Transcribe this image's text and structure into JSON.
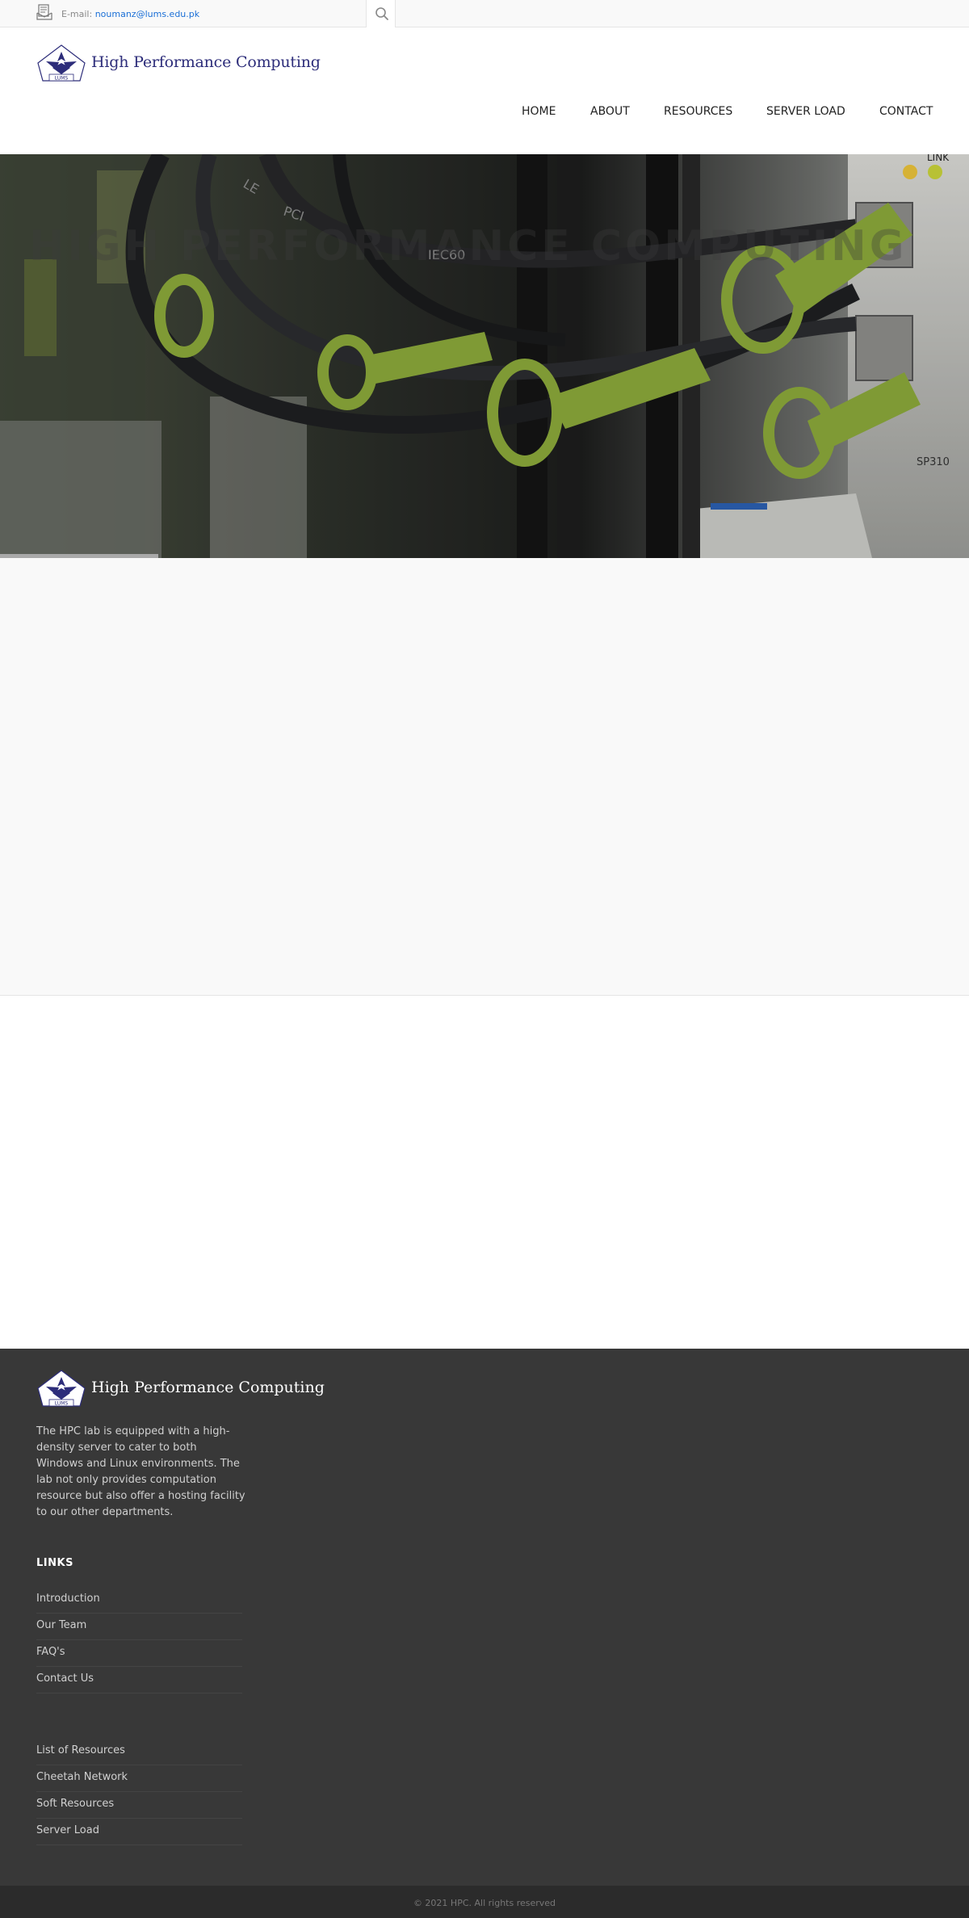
{
  "topbar": {
    "email_label": "E-mail:",
    "email": "noumanz@lums.edu.pk",
    "mail_icon": "mail-icon",
    "search_icon": "search-icon"
  },
  "header": {
    "logo_badge": "LUMS",
    "logo_text": "High Performance Computing",
    "nav": [
      {
        "label": "HOME"
      },
      {
        "label": "ABOUT"
      },
      {
        "label": "RESOURCES"
      },
      {
        "label": "SERVER LOAD"
      },
      {
        "label": "CONTACT"
      }
    ]
  },
  "hero": {
    "title": "HIGH PERFORMANCE COMPUTING",
    "progress": 0.163,
    "photo_labels": {
      "link": "LINK",
      "port": "SP310",
      "cable_a": "PCI",
      "cable_b": "IEC60",
      "cable_c": "LE"
    }
  },
  "footer": {
    "logo_text": "High Performance Computing",
    "about": "The HPC lab is equipped with a high-density server to cater to both Windows and Linux environments. The lab not only provides computation resource but also offer a hosting facility to our other departments.",
    "links_heading": "LINKS",
    "links": [
      {
        "label": "Introduction"
      },
      {
        "label": "Our Team"
      },
      {
        "label": "FAQ's"
      },
      {
        "label": "Contact Us"
      }
    ],
    "resource_links": [
      {
        "label": "List of Resources"
      },
      {
        "label": "Cheetah Network"
      },
      {
        "label": "Soft Resources"
      },
      {
        "label": "Server Load"
      }
    ],
    "copyright": "© 2021 HPC. All rights reserved"
  },
  "colors": {
    "accent_link": "#1a6fd6",
    "logo_navy": "#2d2d7a",
    "footer_bg": "#383838",
    "cable_green": "#8aa83a"
  }
}
